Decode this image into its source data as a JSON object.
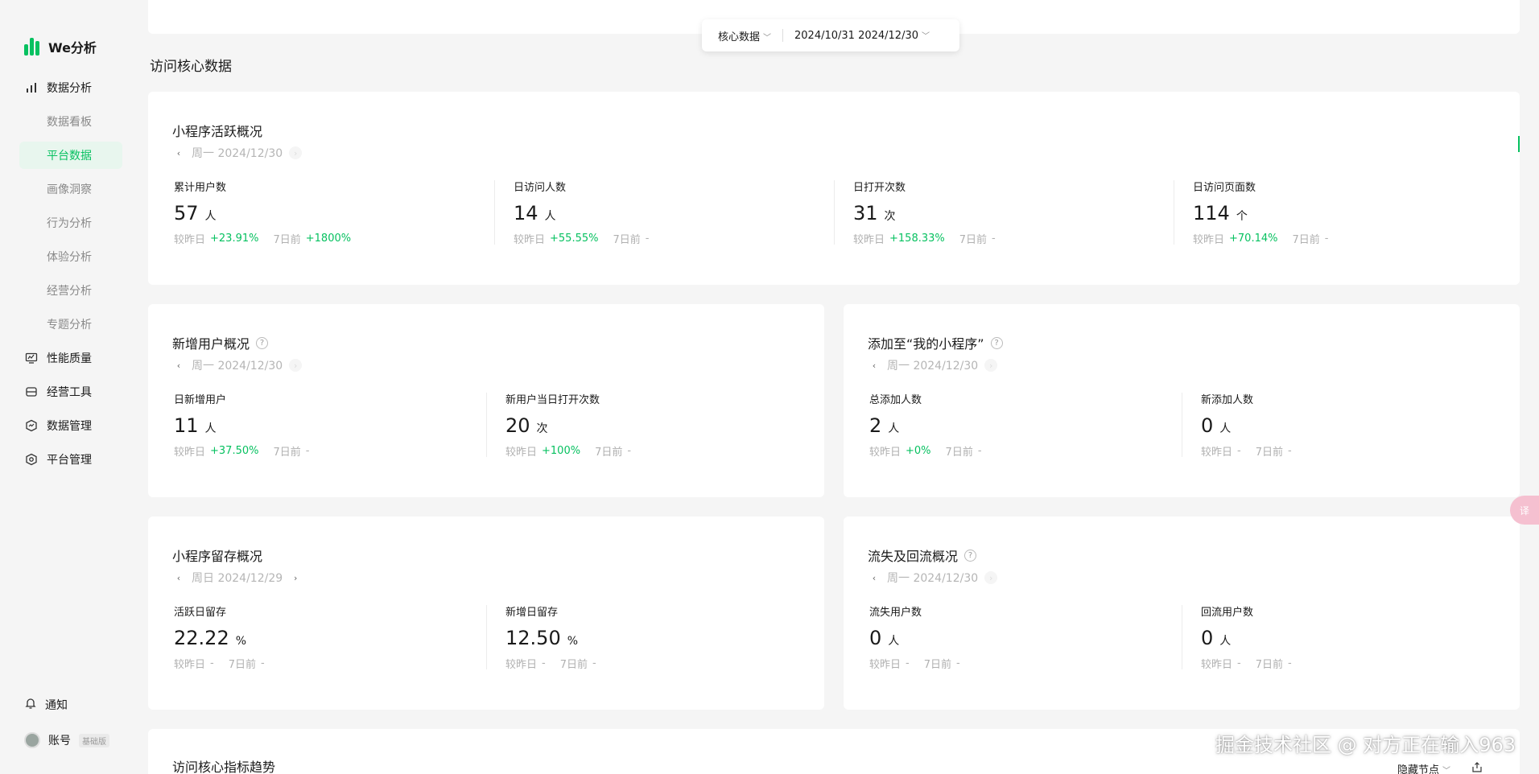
{
  "app": {
    "name": "We分析",
    "brand_color": "#07c160"
  },
  "sidebar": {
    "groups": [
      {
        "label": "数据分析",
        "icon": "bar-chart-icon"
      },
      {
        "label": "性能质量",
        "icon": "monitor-icon"
      },
      {
        "label": "经营工具",
        "icon": "toolbox-icon"
      },
      {
        "label": "数据管理",
        "icon": "trend-shield-icon"
      },
      {
        "label": "平台管理",
        "icon": "hexagon-gear-icon"
      }
    ],
    "sub_items": [
      "数据看板",
      "平台数据",
      "画像洞察",
      "行为分析",
      "体验分析",
      "经营分析",
      "专题分析"
    ],
    "active_sub": "平台数据",
    "notify_label": "通知",
    "account_label": "账号",
    "account_badge": "基础版"
  },
  "filter": {
    "type_label": "核心数据",
    "date_range": "2024/10/31 2024/12/30"
  },
  "section_title": "访问核心数据",
  "cards": {
    "active": {
      "title": "小程序活跃概况",
      "date": "周一 2024/12/30",
      "metrics": [
        {
          "label": "累计用户数",
          "value": "57",
          "unit": "人",
          "day_label": "较昨日",
          "day_change": "+23.91%",
          "week_label": "7日前",
          "week_change": "+1800%"
        },
        {
          "label": "日访问人数",
          "value": "14",
          "unit": "人",
          "day_label": "较昨日",
          "day_change": "+55.55%",
          "week_label": "7日前",
          "week_change": "-"
        },
        {
          "label": "日打开次数",
          "value": "31",
          "unit": "次",
          "day_label": "较昨日",
          "day_change": "+158.33%",
          "week_label": "7日前",
          "week_change": "-"
        },
        {
          "label": "日访问页面数",
          "value": "114",
          "unit": "个",
          "day_label": "较昨日",
          "day_change": "+70.14%",
          "week_label": "7日前",
          "week_change": "-"
        }
      ]
    },
    "new_users": {
      "title": "新增用户概况",
      "date": "周一 2024/12/30",
      "metrics": [
        {
          "label": "日新增用户",
          "value": "11",
          "unit": "人",
          "day_label": "较昨日",
          "day_change": "+37.50%",
          "week_label": "7日前",
          "week_change": "-"
        },
        {
          "label": "新用户当日打开次数",
          "value": "20",
          "unit": "次",
          "day_label": "较昨日",
          "day_change": "+100%",
          "week_label": "7日前",
          "week_change": "-"
        }
      ]
    },
    "added": {
      "title": "添加至“我的小程序”",
      "date": "周一 2024/12/30",
      "metrics": [
        {
          "label": "总添加人数",
          "value": "2",
          "unit": "人",
          "day_label": "较昨日",
          "day_change": "+0%",
          "week_label": "7日前",
          "week_change": "-"
        },
        {
          "label": "新添加人数",
          "value": "0",
          "unit": "人",
          "day_label": "较昨日",
          "day_change": "-",
          "week_label": "7日前",
          "week_change": "-"
        }
      ]
    },
    "retention": {
      "title": "小程序留存概况",
      "date": "周日 2024/12/29",
      "metrics": [
        {
          "label": "活跃日留存",
          "value": "22.22",
          "unit": "%",
          "day_label": "较昨日",
          "day_change": "-",
          "week_label": "7日前",
          "week_change": "-"
        },
        {
          "label": "新增日留存",
          "value": "12.50",
          "unit": "%",
          "day_label": "较昨日",
          "day_change": "-",
          "week_label": "7日前",
          "week_change": "-"
        }
      ]
    },
    "churn": {
      "title": "流失及回流概况",
      "date": "周一 2024/12/30",
      "metrics": [
        {
          "label": "流失用户数",
          "value": "0",
          "unit": "人",
          "day_label": "较昨日",
          "day_change": "-",
          "week_label": "7日前",
          "week_change": "-"
        },
        {
          "label": "回流用户数",
          "value": "0",
          "unit": "人",
          "day_label": "较昨日",
          "day_change": "-",
          "week_label": "7日前",
          "week_change": "-"
        }
      ]
    },
    "trend": {
      "title": "访问核心指标趋势",
      "hide_nodes_label": "隐藏节点"
    }
  },
  "watermark": "掘金技术社区 @ 对方正在输入963"
}
